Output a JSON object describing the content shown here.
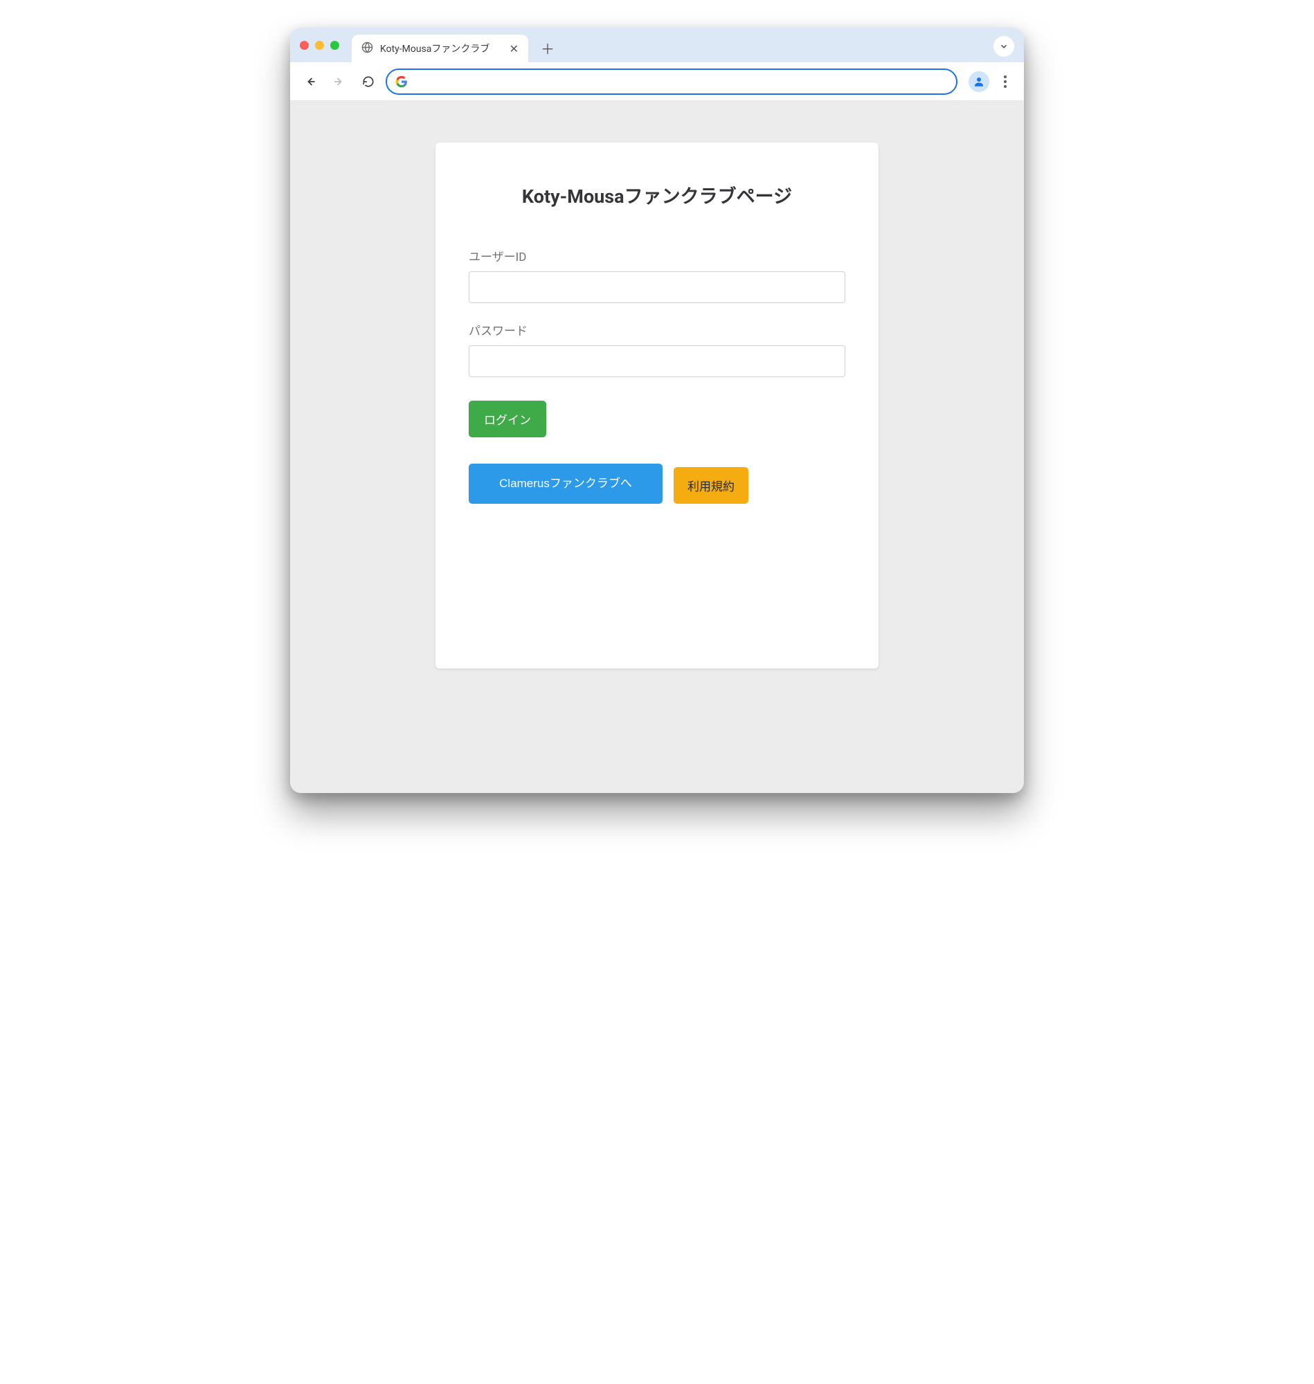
{
  "browser": {
    "tab_title": "Koty-Mousaファンクラブ",
    "omnibox_value": ""
  },
  "page": {
    "title": "Koty-Mousaファンクラブページ",
    "user_id_label": "ユーザーID",
    "password_label": "パスワード",
    "login_button": "ログイン",
    "clamerus_button": "Clamerusファンクラブへ",
    "terms_button": "利用規約"
  }
}
